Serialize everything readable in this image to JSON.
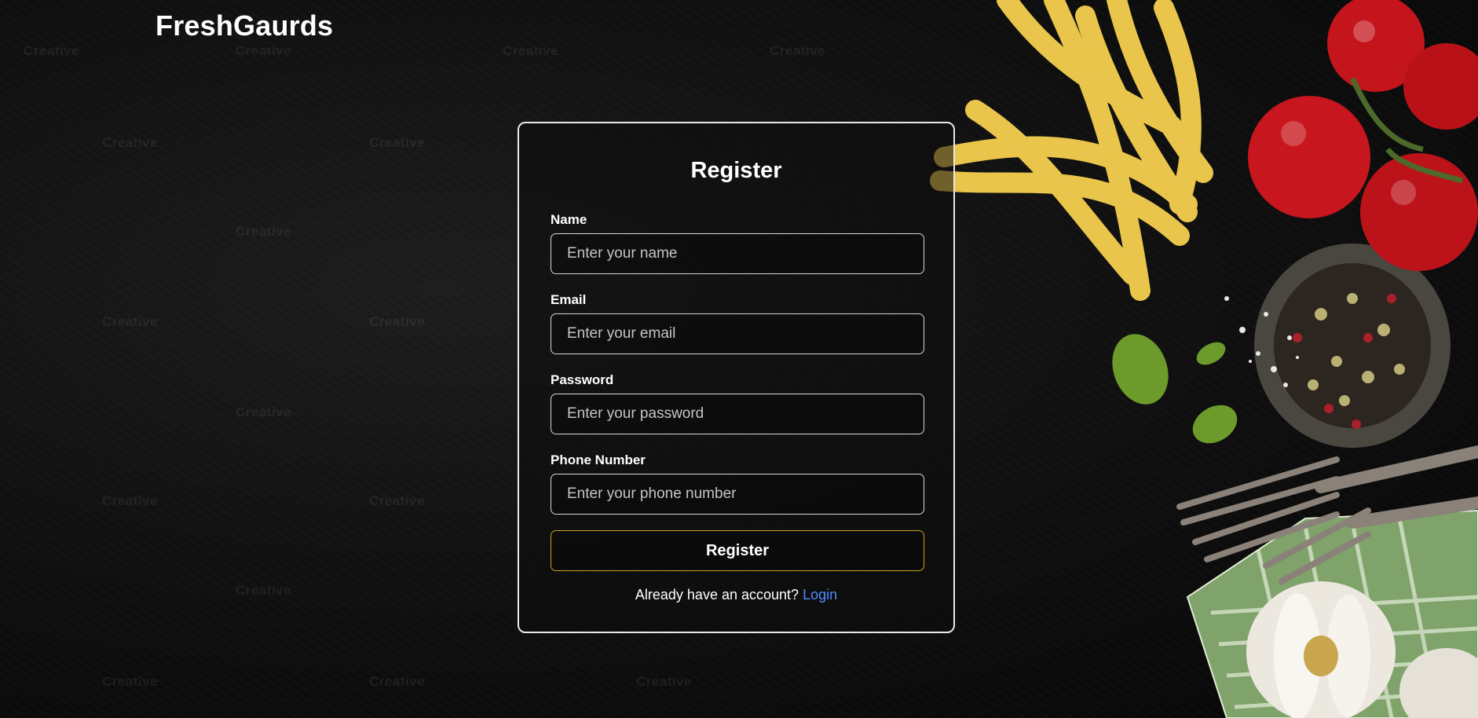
{
  "app": {
    "brand": "FreshGaurds"
  },
  "form": {
    "title": "Register",
    "fields": [
      {
        "label": "Name",
        "placeholder": "Enter your name"
      },
      {
        "label": "Email",
        "placeholder": "Enter your email"
      },
      {
        "label": "Password",
        "placeholder": "Enter your password"
      },
      {
        "label": "Phone Number",
        "placeholder": "Enter your phone number"
      }
    ],
    "submit_label": "Register",
    "footer_text": "Already have an account?",
    "login_link": "Login"
  },
  "watermark": "Creative",
  "colors": {
    "accent_border": "#c9a227",
    "link": "#4f8bff",
    "card_border": "#e9e9e9"
  }
}
